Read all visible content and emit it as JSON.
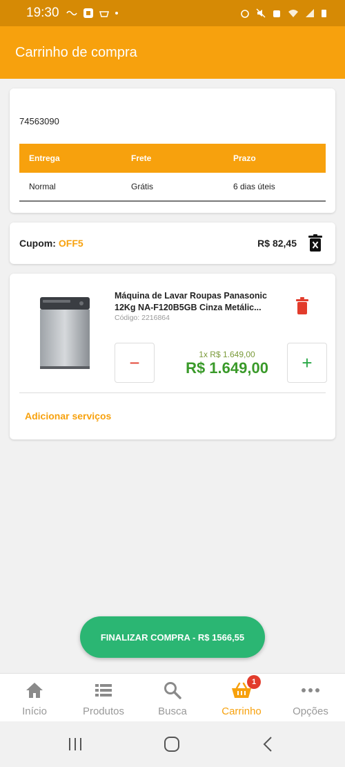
{
  "status_bar": {
    "time": "19:30"
  },
  "app_bar": {
    "title": "Carrinho de compra"
  },
  "shipping": {
    "cep": "74563090",
    "headers": [
      "Entrega",
      "Frete",
      "Prazo"
    ],
    "row": [
      "Normal",
      "Grátis",
      "6 dias úteis"
    ]
  },
  "coupon": {
    "label": "Cupom:",
    "code": "OFF5",
    "value": "R$ 82,45"
  },
  "product": {
    "name": "Máquina de Lavar Roupas Panasonic 12Kg NA-F120B5GB Cinza Metálic...",
    "code": "Código: 2216864",
    "minus": "−",
    "plus": "+",
    "unit_price": "1x R$ 1.649,00",
    "total_price": "R$ 1.649,00",
    "add_services": "Adicionar serviços"
  },
  "checkout": {
    "label": "FINALIZAR COMPRA - R$ 1566,55"
  },
  "bottom_nav": {
    "items": [
      {
        "label": "Início",
        "icon": "home-icon"
      },
      {
        "label": "Produtos",
        "icon": "list-icon"
      },
      {
        "label": "Busca",
        "icon": "search-icon"
      },
      {
        "label": "Carrinho",
        "icon": "basket-icon"
      },
      {
        "label": "Opções",
        "icon": "more-icon"
      }
    ],
    "cart_badge": "1",
    "active": "Carrinho"
  },
  "colors": {
    "primary": "#f7a10d",
    "status_bar": "#d68a05",
    "checkout": "#2bb673",
    "price_green": "#3a9a2a",
    "danger": "#e23c2c"
  }
}
